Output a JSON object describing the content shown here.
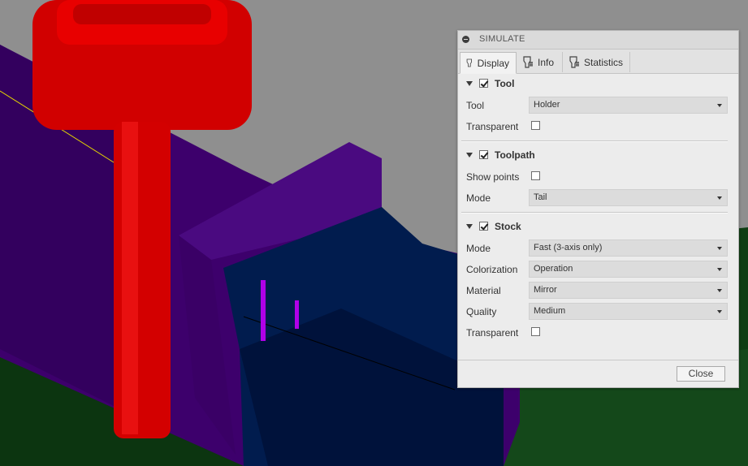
{
  "panel": {
    "title": "SIMULATE",
    "tabs": [
      {
        "label": "Display",
        "icon": "display-tool-icon"
      },
      {
        "label": "Info",
        "icon": "info-tool-icon"
      },
      {
        "label": "Statistics",
        "icon": "statistics-tool-icon"
      }
    ],
    "tool": {
      "label": "Tool",
      "enabled": true,
      "tool_label": "Tool",
      "tool_value": "Holder",
      "transparent_label": "Transparent",
      "transparent": false
    },
    "toolpath": {
      "label": "Toolpath",
      "enabled": true,
      "show_points_label": "Show points",
      "show_points": false,
      "mode_label": "Mode",
      "mode_value": "Tail"
    },
    "stock": {
      "label": "Stock",
      "enabled": true,
      "mode_label": "Mode",
      "mode_value": "Fast (3-axis only)",
      "colorization_label": "Colorization",
      "colorization_value": "Operation",
      "material_label": "Material",
      "material_value": "Mirror",
      "quality_label": "Quality",
      "quality_value": "Medium",
      "transparent_label": "Transparent",
      "transparent": false
    },
    "close_label": "Close"
  },
  "colors": {
    "background": "#8f8f8f",
    "tool_red": "#d60000",
    "stock_purple": "#3f0070",
    "stock_navy": "#001a4d",
    "fixture_green": "#0e3a0e",
    "panel_bg": "#ececec"
  }
}
